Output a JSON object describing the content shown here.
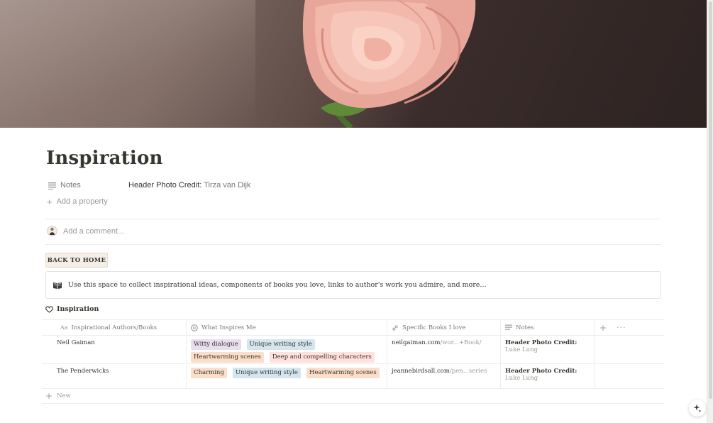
{
  "page": {
    "title": "Inspiration"
  },
  "cover": {
    "icon": "rose-cover-image"
  },
  "properties": [
    {
      "icon": "lines-icon",
      "name": "Notes",
      "value_prefix": "Header Photo Credit: ",
      "value_link": "Tirza van Dijk"
    }
  ],
  "add_property_label": "Add a property",
  "comment": {
    "placeholder": "Add a comment..."
  },
  "back_button": {
    "label": "BACK TO HOME"
  },
  "callout": {
    "icon": "open-book-icon",
    "text": "Use this space to collect inspirational ideas, components of books you love, links to author's work you admire, and more..."
  },
  "database": {
    "title": "Inspiration",
    "title_icon": "heart-icon",
    "columns": [
      {
        "icon": "text-aa-icon",
        "label": "Inspirational Authors/Books"
      },
      {
        "icon": "multiselect-icon",
        "label": "What Inspires Me"
      },
      {
        "icon": "link-icon",
        "label": "Specific Books I love"
      },
      {
        "icon": "lines-icon",
        "label": "Notes"
      }
    ],
    "rows": [
      {
        "name": "Neil Gaiman",
        "tags": [
          {
            "label": "Witty dialogue",
            "color": "#e8deee"
          },
          {
            "label": "Unique writing style",
            "color": "#d3e5ef"
          },
          {
            "label": "Heartwarming scenes",
            "color": "#fadec9"
          },
          {
            "label": "Deep and compelling characters",
            "color": "#ffe2dd"
          }
        ],
        "url_domain": "neilgaiman.com",
        "url_path": "/wor...+Book/",
        "notes_prefix": "Header Photo Credit:",
        "notes_link": "Luke Lung"
      },
      {
        "name": "The Penderwicks",
        "tags": [
          {
            "label": "Charming",
            "color": "#fadec9"
          },
          {
            "label": "Unique writing style",
            "color": "#d3e5ef"
          },
          {
            "label": "Heartwarming scenes",
            "color": "#fadec9"
          }
        ],
        "url_domain": "jeannebirdsall.com",
        "url_path": "/pen...series",
        "notes_prefix": "Header Photo Credit:",
        "notes_link": "Luke Lung"
      }
    ],
    "new_label": "New"
  }
}
